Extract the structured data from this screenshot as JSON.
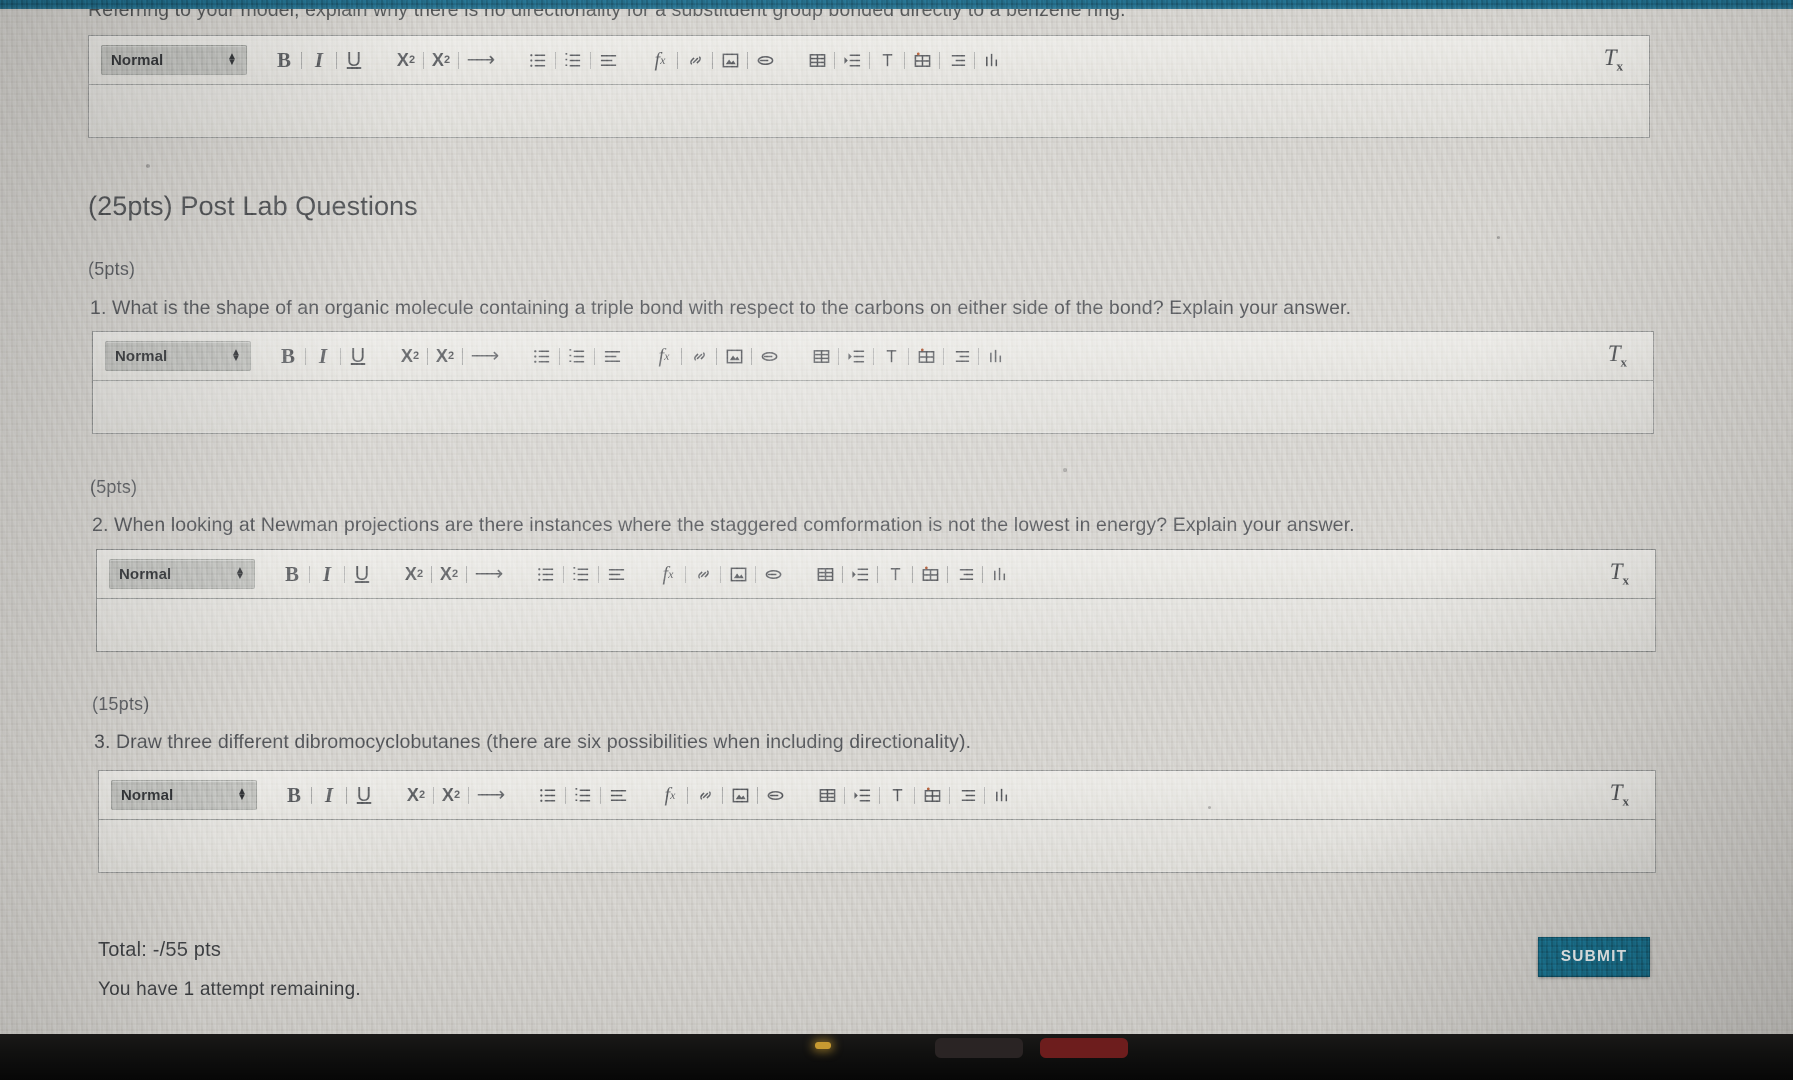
{
  "page": {
    "prompt_top": "Referring to your model, explain why there is no directionality for a substituent group bonded directly to a benzene ring.",
    "section_title": "(25pts) Post Lab Questions",
    "total_label": "Total: -/55 pts",
    "attempts_label": "You have 1 attempt remaining.",
    "submit_label": "SUBMIT",
    "accent_color": "#18647d",
    "top_bar_color": "#1d5f79"
  },
  "questions": [
    {
      "points": "(5pts)",
      "text": "1. What is the shape of an organic molecule containing a triple bond with respect to the carbons on either side of the bond? Explain your answer."
    },
    {
      "points": "(5pts)",
      "text": "2. When looking at Newman projections are there instances where the staggered comformation is not the lowest in energy? Explain your answer."
    },
    {
      "points": "(15pts)",
      "text": "3. Draw three different dibromocyclobutanes (there are six possibilities when including directionality)."
    }
  ],
  "editor": {
    "format_value": "Normal",
    "body_value": "",
    "body_placeholder": "",
    "buttons": {
      "bold": "B",
      "italic": "I",
      "underline": "U",
      "subscript": "X",
      "subscript_index": "2",
      "superscript": "X",
      "superscript_index": "2",
      "arrow": "⟶",
      "formula": "f",
      "formula_index": "x",
      "clear_format": "T",
      "clear_format_index": "x"
    },
    "icon_names": [
      "bullet-list-icon",
      "numbered-list-icon",
      "align-icon",
      "formula-icon",
      "link-icon",
      "image-icon",
      "attachment-icon",
      "table-icon",
      "indent-icon",
      "text-color-icon",
      "media-icon",
      "align-right-icon",
      "chart-icon"
    ]
  }
}
